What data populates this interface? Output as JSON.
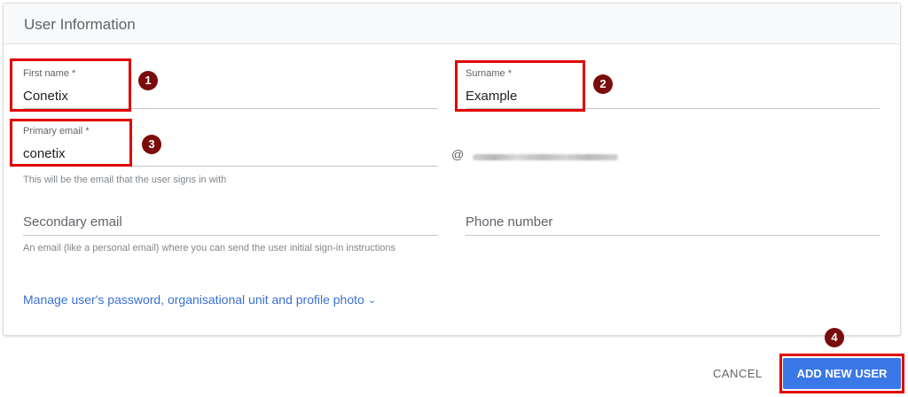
{
  "card": {
    "title": "User Information"
  },
  "form": {
    "first_name": {
      "label": "First name *",
      "value": "Conetix"
    },
    "surname": {
      "label": "Surname *",
      "value": "Example"
    },
    "primary_email": {
      "label": "Primary email *",
      "value": "conetix",
      "helper": "This will be the email that the user signs in with",
      "at_sign": "@"
    },
    "secondary_email": {
      "placeholder": "Secondary email",
      "helper": "An email (like a personal email) where you can send the user initial sign-in instructions"
    },
    "phone_number": {
      "placeholder": "Phone number"
    },
    "manage_link": "Manage user's password, organisational unit and profile photo"
  },
  "annotations": {
    "m1": "1",
    "m2": "2",
    "m3": "3",
    "m4": "4",
    "highlight_color": "#e00000",
    "marker_color": "#7b0c0c"
  },
  "actions": {
    "cancel": "CANCEL",
    "add_new_user": "ADD NEW USER",
    "primary_color": "#3b78e7"
  }
}
